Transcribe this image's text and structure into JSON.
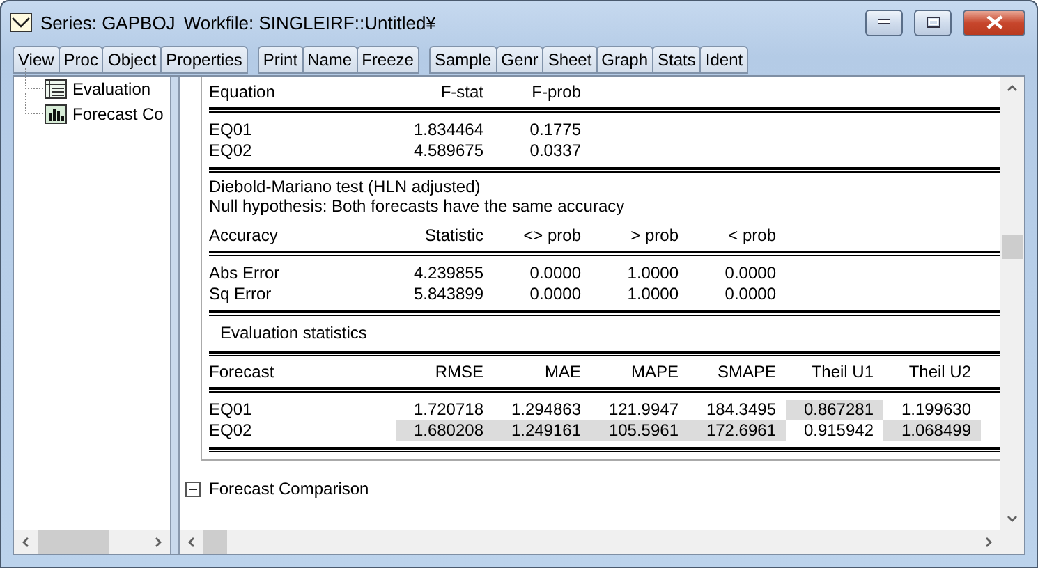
{
  "window": {
    "title": "Series: GAPBOJ",
    "workfile": "Workfile: SINGLEIRF::Untitled¥"
  },
  "toolbar": [
    [
      "View",
      "Proc",
      "Object",
      "Properties"
    ],
    [
      "Print",
      "Name",
      "Freeze"
    ],
    [
      "Sample",
      "Genr",
      "Sheet",
      "Graph",
      "Stats",
      "Ident"
    ]
  ],
  "tree": {
    "items": [
      {
        "label": "Evaluation",
        "kind": "table"
      },
      {
        "label": "Forecast Co",
        "kind": "graph"
      }
    ]
  },
  "output": {
    "blocks": [
      {
        "kind": "table",
        "columns": [
          "Equation",
          "F-stat",
          "F-prob"
        ],
        "rows": [
          {
            "cells": [
              {
                "text": "EQ01",
                "highlighted": false
              },
              {
                "text": "1.834464",
                "highlighted": false
              },
              {
                "text": "0.1775",
                "highlighted": false
              }
            ]
          },
          {
            "cells": [
              {
                "text": "EQ02",
                "highlighted": false
              },
              {
                "text": "4.589675",
                "highlighted": false
              },
              {
                "text": "0.0337",
                "highlighted": false
              }
            ]
          }
        ]
      },
      {
        "kind": "note",
        "lines": [
          "Diebold-Mariano test (HLN adjusted)",
          "Null hypothesis: Both forecasts have the same accuracy"
        ]
      },
      {
        "kind": "table",
        "columns": [
          "Accuracy",
          "Statistic",
          "<> prob",
          "> prob",
          "< prob"
        ],
        "rows": [
          {
            "cells": [
              {
                "text": "Abs Error",
                "highlighted": false
              },
              {
                "text": "4.239855",
                "highlighted": false
              },
              {
                "text": "0.0000",
                "highlighted": false
              },
              {
                "text": "1.0000",
                "highlighted": false
              },
              {
                "text": "0.0000",
                "highlighted": false
              }
            ]
          },
          {
            "cells": [
              {
                "text": "Sq Error",
                "highlighted": false
              },
              {
                "text": "5.843899",
                "highlighted": false
              },
              {
                "text": "0.0000",
                "highlighted": false
              },
              {
                "text": "1.0000",
                "highlighted": false
              },
              {
                "text": "0.0000",
                "highlighted": false
              }
            ]
          }
        ]
      },
      {
        "kind": "caption",
        "text": "Evaluation statistics"
      },
      {
        "kind": "table",
        "columns": [
          "Forecast",
          "RMSE",
          "MAE",
          "MAPE",
          "SMAPE",
          "Theil U1",
          "Theil U2"
        ],
        "rows": [
          {
            "cells": [
              {
                "text": "EQ01",
                "highlighted": false
              },
              {
                "text": "1.720718",
                "highlighted": false
              },
              {
                "text": "1.294863",
                "highlighted": false
              },
              {
                "text": "121.9947",
                "highlighted": false
              },
              {
                "text": "184.3495",
                "highlighted": false
              },
              {
                "text": "0.867281",
                "highlighted": true
              },
              {
                "text": "1.199630",
                "highlighted": false
              }
            ]
          },
          {
            "cells": [
              {
                "text": "EQ02",
                "highlighted": false
              },
              {
                "text": "1.680208",
                "highlighted": true
              },
              {
                "text": "1.249161",
                "highlighted": true
              },
              {
                "text": "105.5961",
                "highlighted": true
              },
              {
                "text": "172.6961",
                "highlighted": true
              },
              {
                "text": "0.915942",
                "highlighted": false
              },
              {
                "text": "1.068499",
                "highlighted": true
              }
            ]
          }
        ]
      }
    ]
  },
  "section": {
    "label": "Forecast Comparison",
    "expanded": true
  }
}
